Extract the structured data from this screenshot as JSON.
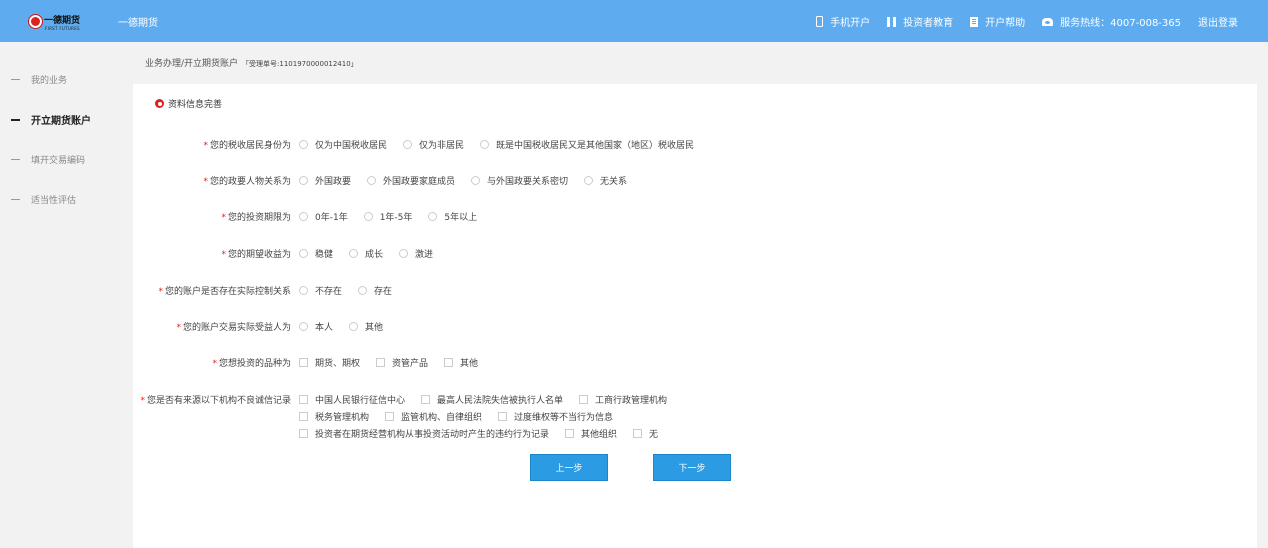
{
  "header": {
    "logo_text": "一德期货",
    "logo_sub": "FIRST FUTURES",
    "brand": "一德期货",
    "nav": [
      {
        "icon": "phone-icon",
        "label": "手机开户"
      },
      {
        "icon": "education-icon",
        "label": "投资者教育"
      },
      {
        "icon": "help-icon",
        "label": "开户帮助"
      },
      {
        "icon": "telephone-icon",
        "label": "服务热线：4007-008-365"
      },
      {
        "icon": "",
        "label": "退出登录"
      }
    ]
  },
  "sidebar": {
    "items": [
      {
        "label": "我的业务",
        "active": false
      },
      {
        "label": "开立期货账户",
        "active": true
      },
      {
        "label": "填开交易编码",
        "active": false
      },
      {
        "label": "适当性评估",
        "active": false
      }
    ]
  },
  "breadcrumb": {
    "path": "业务办理/开立期货账户",
    "ticket": "「受理单号:1101970000012410」"
  },
  "form": {
    "section_title": "资料信息完善",
    "questions": [
      {
        "label": "您的税收居民身份为",
        "type": "radio",
        "options": [
          "仅为中国税收居民",
          "仅为非居民",
          "既是中国税收居民又是其他国家（地区）税收居民"
        ]
      },
      {
        "label": "您的政要人物关系为",
        "type": "radio",
        "options": [
          "外国政要",
          "外国政要家庭成员",
          "与外国政要关系密切",
          "无关系"
        ]
      },
      {
        "label": "您的投资期限为",
        "type": "radio",
        "options": [
          "0年-1年",
          "1年-5年",
          "5年以上"
        ]
      },
      {
        "label": "您的期望收益为",
        "type": "radio",
        "options": [
          "稳健",
          "成长",
          "激进"
        ]
      },
      {
        "label": "您的账户是否存在实际控制关系",
        "type": "radio",
        "options": [
          "不存在",
          "存在"
        ]
      },
      {
        "label": "您的账户交易实际受益人为",
        "type": "radio",
        "options": [
          "本人",
          "其他"
        ]
      },
      {
        "label": "您想投资的品种为",
        "type": "checkbox",
        "options": [
          "期货、期权",
          "资管产品",
          "其他"
        ]
      },
      {
        "label": "您是否有来源以下机构不良诚信记录",
        "type": "checkbox",
        "rows": [
          [
            "中国人民银行征信中心",
            "最高人民法院失信被执行人名单",
            "工商行政管理机构"
          ],
          [
            "税务管理机构",
            "监管机构、自律组织",
            "过度维权等不当行为信息"
          ],
          [
            "投资者在期货经营机构从事投资活动时产生的违约行为记录",
            "其他组织",
            "无"
          ]
        ]
      }
    ],
    "prev_label": "上一步",
    "next_label": "下一步"
  },
  "colors": {
    "header": "#5eacef",
    "button": "#2b9be3",
    "required": "#e02020"
  }
}
